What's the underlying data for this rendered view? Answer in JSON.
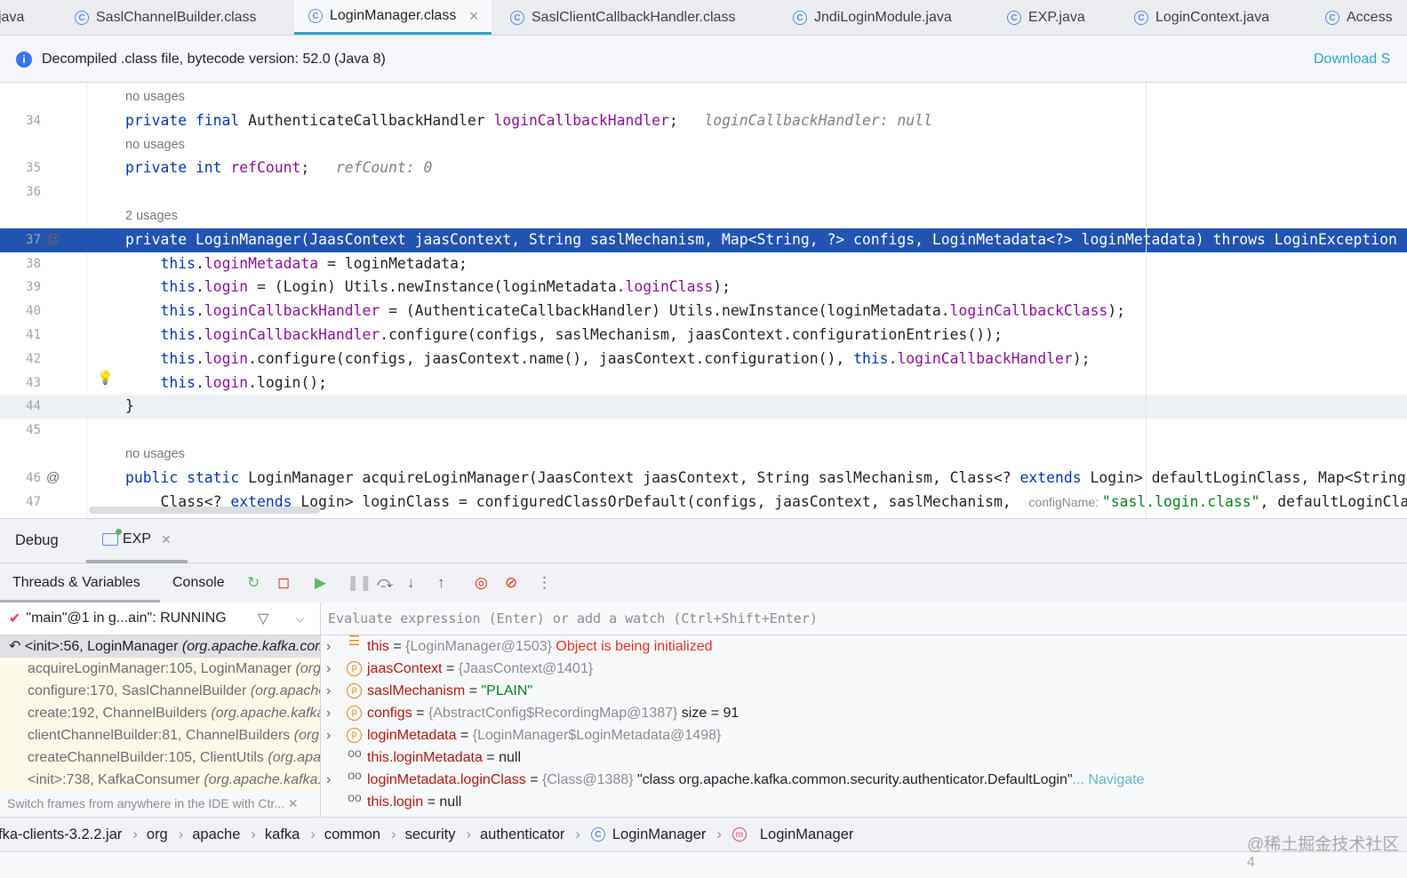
{
  "tabs": [
    {
      "label": "java",
      "icon": "none"
    },
    {
      "label": "SaslChannelBuilder.class",
      "icon": "class-icon"
    },
    {
      "label": "LoginManager.class",
      "icon": "class-icon",
      "active": true
    },
    {
      "label": "SaslClientCallbackHandler.class",
      "icon": "class-icon"
    },
    {
      "label": "JndiLoginModule.java",
      "icon": "class-icon"
    },
    {
      "label": "EXP.java",
      "icon": "class-icon"
    },
    {
      "label": "LoginContext.java",
      "icon": "class-icon"
    },
    {
      "label": "Access",
      "icon": "class-icon"
    }
  ],
  "banner": {
    "text": "Decompiled .class file, bytecode version: 52.0 (Java 8)",
    "link": "Download S"
  },
  "code": [
    {
      "ln": "",
      "hint": true,
      "segs": [
        [
          "no usages",
          ""
        ]
      ]
    },
    {
      "ln": "34",
      "segs": [
        [
          "private final ",
          "kw"
        ],
        [
          "AuthenticateCallbackHandler ",
          ""
        ],
        [
          "loginCallbackHandler",
          "fld"
        ],
        [
          ";   ",
          ""
        ],
        [
          "loginCallbackHandler: null",
          "inl"
        ]
      ]
    },
    {
      "ln": "",
      "hint": true,
      "segs": [
        [
          "no usages",
          ""
        ]
      ]
    },
    {
      "ln": "35",
      "segs": [
        [
          "private int ",
          "kw"
        ],
        [
          "refCount",
          "fld"
        ],
        [
          ";   ",
          ""
        ],
        [
          "refCount: 0",
          "inl"
        ]
      ]
    },
    {
      "ln": "36",
      "segs": []
    },
    {
      "ln": "",
      "hint": true,
      "segs": [
        [
          "2 usages",
          ""
        ]
      ]
    },
    {
      "ln": "37",
      "at": true,
      "sel": true,
      "segs": [
        [
          "private LoginManager(JaasContext jaasContext, String saslMechanism, Map<String, ?> configs, LoginMetadata<?> loginMetadata) throws LoginException {",
          ""
        ]
      ]
    },
    {
      "ln": "38",
      "segs": [
        [
          "    this",
          "kw"
        ],
        [
          ".",
          ""
        ],
        [
          "loginMetadata",
          "fld"
        ],
        [
          " = loginMetadata;",
          ""
        ]
      ]
    },
    {
      "ln": "39",
      "segs": [
        [
          "    this",
          "kw"
        ],
        [
          ".",
          ""
        ],
        [
          "login",
          "fld"
        ],
        [
          " = (Login) Utils.",
          ""
        ],
        [
          "newInstance",
          "fn"
        ],
        [
          "(loginMetadata.",
          ""
        ],
        [
          "loginClass",
          "fld"
        ],
        [
          ");",
          ""
        ]
      ]
    },
    {
      "ln": "40",
      "segs": [
        [
          "    this",
          "kw"
        ],
        [
          ".",
          ""
        ],
        [
          "loginCallbackHandler",
          "fld"
        ],
        [
          " = (AuthenticateCallbackHandler) Utils.newInstance(loginMetadata.",
          ""
        ],
        [
          "loginCallbackClass",
          "fld"
        ],
        [
          ");",
          ""
        ]
      ]
    },
    {
      "ln": "41",
      "segs": [
        [
          "    this",
          "kw"
        ],
        [
          ".",
          ""
        ],
        [
          "loginCallbackHandler",
          "fld"
        ],
        [
          ".configure(configs, saslMechanism, jaasContext.configurationEntries());",
          ""
        ]
      ]
    },
    {
      "ln": "42",
      "segs": [
        [
          "    this",
          "kw"
        ],
        [
          ".",
          ""
        ],
        [
          "login",
          "fld"
        ],
        [
          ".configure(configs, jaasContext.name(), jaasContext.configuration(), ",
          ""
        ],
        [
          "this",
          "kw"
        ],
        [
          ".",
          ""
        ],
        [
          "loginCallbackHandler",
          "fld"
        ],
        [
          ");",
          ""
        ]
      ]
    },
    {
      "ln": "43",
      "segs": [
        [
          "    this",
          "kw"
        ],
        [
          ".",
          ""
        ],
        [
          "login",
          "fld"
        ],
        [
          ".login();",
          ""
        ]
      ]
    },
    {
      "ln": "44",
      "cur": true,
      "segs": [
        [
          "}",
          ""
        ]
      ]
    },
    {
      "ln": "45",
      "segs": []
    },
    {
      "ln": "",
      "hint": true,
      "segs": [
        [
          "no usages",
          ""
        ]
      ]
    },
    {
      "ln": "46",
      "at": true,
      "segs": [
        [
          "public static ",
          "kw"
        ],
        [
          "LoginManager acquireLoginManager(JaasContext jaasContext, String saslMechanism, Class<? ",
          ""
        ],
        [
          "extends",
          "kw"
        ],
        [
          " Login> defaultLoginClass, Map<String, ?> configs)",
          ""
        ]
      ]
    },
    {
      "ln": "47",
      "segs": [
        [
          "    Class<? ",
          ""
        ],
        [
          "extends",
          "kw"
        ],
        [
          " Login> loginClass = configuredClassOrDefault(configs, jaasContext, saslMechanism,  ",
          ""
        ],
        [
          "configName: ",
          "ph"
        ],
        [
          "\"sasl.login.class\"",
          "str"
        ],
        [
          ", defaultLoginClass);",
          ""
        ]
      ]
    }
  ],
  "debug": {
    "title": "Debug",
    "session_tab": "EXP",
    "tabs": [
      "Threads & Variables",
      "Console"
    ],
    "thread": "\"main\"@1 in g...ain\": RUNNING",
    "eval_placeholder": "Evaluate expression (Enter) or add a watch (Ctrl+Shift+Enter)",
    "frames": [
      {
        "m": "<init>:56, LoginManager ",
        "p": "(org.apache.kafka.common.security.authenticator)"
      },
      {
        "m": "acquireLoginManager:105, LoginManager ",
        "p": "(org.apache.kafka.common.security.authenticator)"
      },
      {
        "m": "configure:170, SaslChannelBuilder ",
        "p": "(org.apache.kafka.common.network)"
      },
      {
        "m": "create:192, ChannelBuilders ",
        "p": "(org.apache.kafka.common.network)"
      },
      {
        "m": "clientChannelBuilder:81, ChannelBuilders ",
        "p": "(org.apache.kafka.common.network)"
      },
      {
        "m": "createChannelBuilder:105, ClientUtils ",
        "p": "(org.apache.kafka.clients)"
      },
      {
        "m": "<init>:738, KafkaConsumer ",
        "p": "(org.apache.kafka.clients.consumer)"
      }
    ],
    "tip": "Switch frames from anywhere in the IDE with Ctr...",
    "variables": [
      {
        "icon": "t",
        "exp": true,
        "name": "this",
        "val": "{LoginManager@1503}",
        "extra": " Object is being initialized",
        "extraCls": "vr"
      },
      {
        "icon": "p",
        "exp": true,
        "name": "jaasContext",
        "val": "{JaasContext@1401}"
      },
      {
        "icon": "p",
        "exp": true,
        "name": "saslMechanism",
        "str": "\"PLAIN\""
      },
      {
        "icon": "p",
        "exp": true,
        "name": "configs",
        "val": "{AbstractConfig$RecordingMap@1387}",
        "extra": "  size = 91",
        "extraCls": "vp"
      },
      {
        "icon": "p",
        "exp": true,
        "name": "loginMetadata",
        "val": "{LoginManager$LoginMetadata@1498}"
      },
      {
        "icon": "w",
        "exp": false,
        "name": "this.loginMetadata",
        "plain": "null"
      },
      {
        "icon": "w",
        "exp": true,
        "name": "loginMetadata.loginClass",
        "val": "{Class@1388}",
        "extra": " \"class org.apache.kafka.common.security.authenticator.DefaultLogin\"",
        "extraCls": "vp",
        "link": "... Navigate"
      },
      {
        "icon": "w",
        "exp": false,
        "name": "this.login",
        "plain": "null"
      }
    ]
  },
  "breadcrumb": [
    "fka-clients-3.2.2.jar",
    "org",
    "apache",
    "kafka",
    "common",
    "security",
    "authenticator",
    "LoginManager",
    "LoginManager"
  ],
  "watermark": "@稀土掘金技术社区",
  "corner_digit": "4"
}
